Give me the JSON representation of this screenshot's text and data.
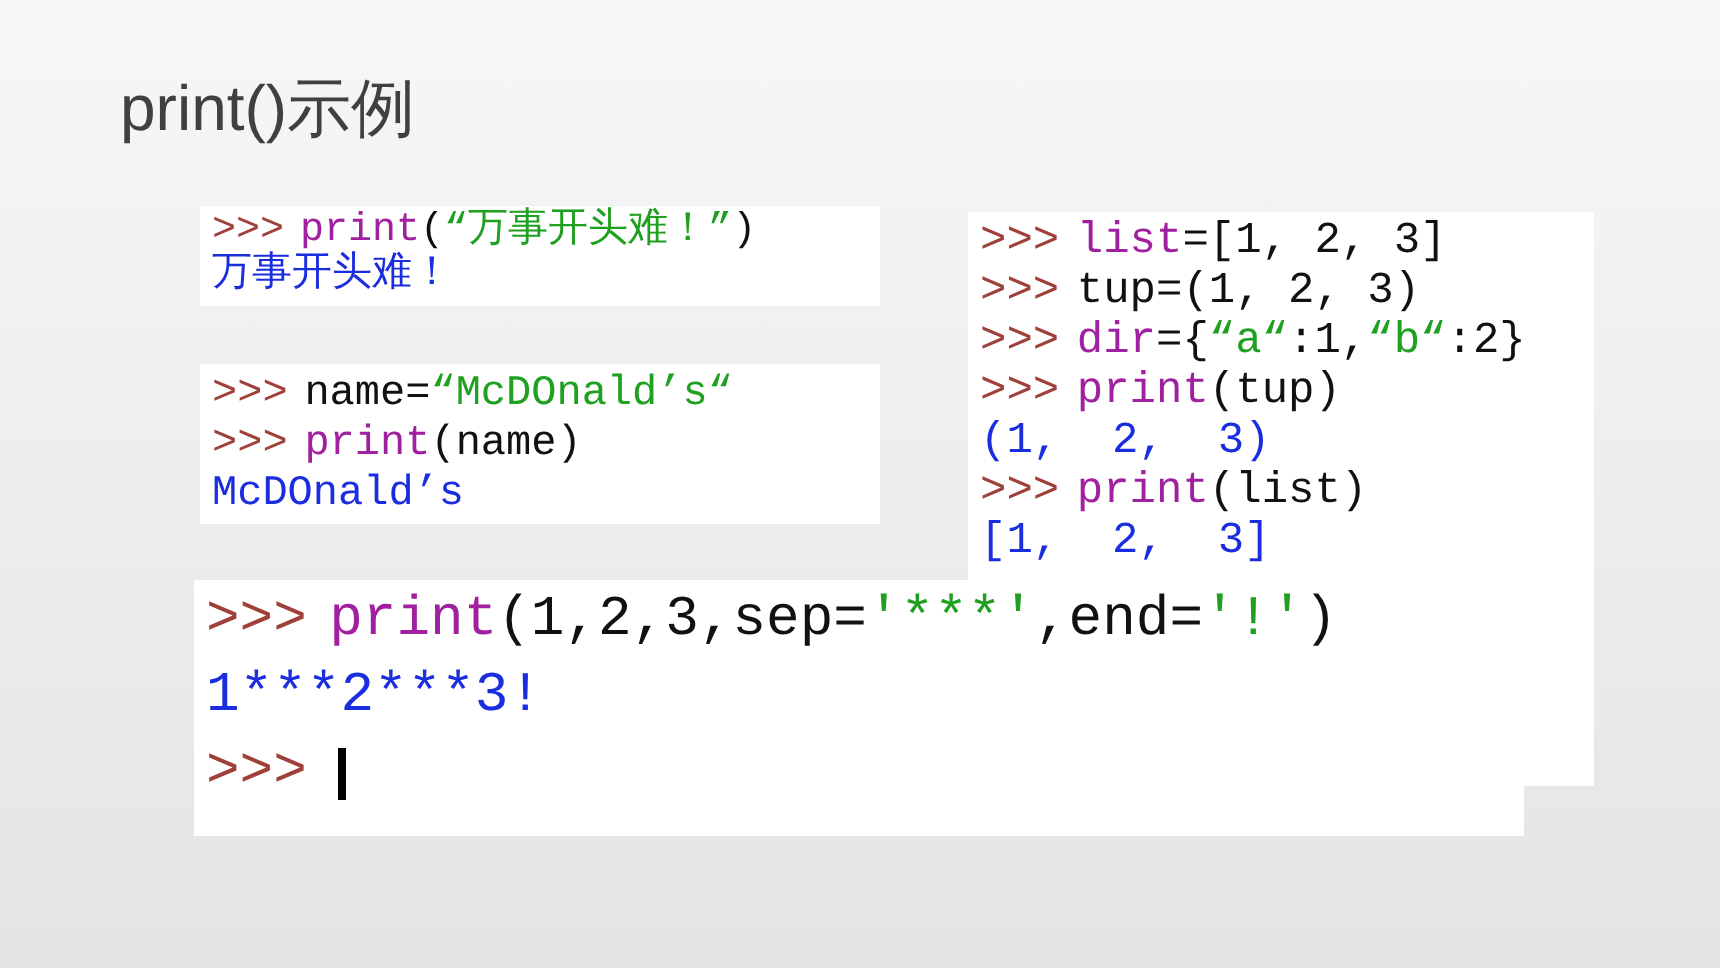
{
  "slide": {
    "title": "print()示例"
  },
  "panels": [
    {
      "lines": [
        [
          {
            "kind": "prompt",
            "text": ">>>"
          },
          {
            "kind": "keyword",
            "text": "print"
          },
          {
            "kind": "plain",
            "text": "("
          },
          {
            "kind": "string",
            "text": "“万事开头难！”"
          },
          {
            "kind": "plain",
            "text": ")"
          }
        ],
        [
          {
            "kind": "output",
            "text": "万事开头难！"
          }
        ]
      ]
    },
    {
      "lines": [
        [
          {
            "kind": "prompt",
            "text": ">>>"
          },
          {
            "kind": "keyword",
            "text": "list"
          },
          {
            "kind": "plain",
            "text": "=[1, 2, 3]"
          }
        ],
        [
          {
            "kind": "prompt",
            "text": ">>>"
          },
          {
            "kind": "plain",
            "text": "tup=(1, 2, 3)"
          }
        ],
        [
          {
            "kind": "prompt",
            "text": ">>>"
          },
          {
            "kind": "keyword",
            "text": "dir"
          },
          {
            "kind": "plain",
            "text": "={"
          },
          {
            "kind": "string",
            "text": "“a“"
          },
          {
            "kind": "plain",
            "text": ":1,"
          },
          {
            "kind": "string",
            "text": "“b“"
          },
          {
            "kind": "plain",
            "text": ":2}"
          }
        ],
        [
          {
            "kind": "prompt",
            "text": ">>>"
          },
          {
            "kind": "keyword",
            "text": "print"
          },
          {
            "kind": "plain",
            "text": "(tup)"
          }
        ],
        [
          {
            "kind": "output",
            "text": "(1,  2,  3)"
          }
        ],
        [
          {
            "kind": "prompt",
            "text": ">>>"
          },
          {
            "kind": "keyword",
            "text": "print"
          },
          {
            "kind": "plain",
            "text": "(list)"
          }
        ],
        [
          {
            "kind": "output",
            "text": "[1,  2,  3]"
          }
        ]
      ]
    },
    {
      "lines": [
        [
          {
            "kind": "prompt",
            "text": ">>>"
          },
          {
            "kind": "plain",
            "text": "name="
          },
          {
            "kind": "string",
            "text": "“McDOnald’s“"
          }
        ],
        [
          {
            "kind": "prompt",
            "text": ">>>"
          },
          {
            "kind": "keyword",
            "text": "print"
          },
          {
            "kind": "plain",
            "text": "(name)"
          }
        ],
        [
          {
            "kind": "output",
            "text": "McDOnald’s"
          }
        ]
      ]
    },
    {
      "lines": [
        [
          {
            "kind": "prompt",
            "text": ">>>"
          },
          {
            "kind": "keyword",
            "text": "print"
          },
          {
            "kind": "plain",
            "text": "(1,2,3,sep="
          },
          {
            "kind": "string",
            "text": "'***'"
          },
          {
            "kind": "plain",
            "text": ",end="
          },
          {
            "kind": "string",
            "text": "'!'"
          },
          {
            "kind": "plain",
            "text": ")"
          }
        ],
        [
          {
            "kind": "output",
            "text": "1***2***3!"
          }
        ],
        [
          {
            "kind": "prompt",
            "text": ">>>"
          },
          {
            "kind": "cursor"
          }
        ]
      ]
    }
  ]
}
